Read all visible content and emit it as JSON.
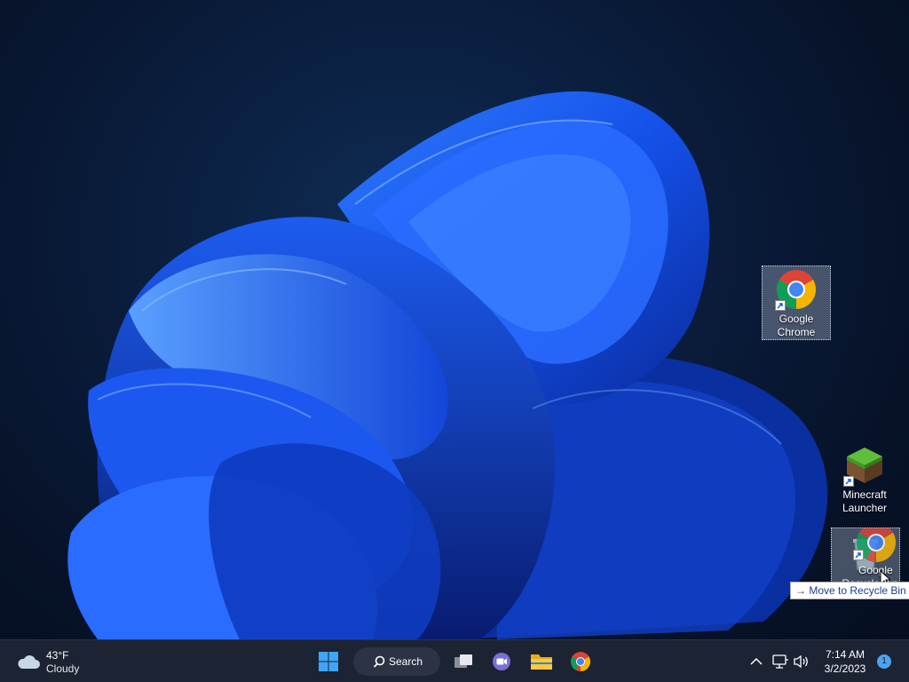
{
  "desktop": {
    "icons": [
      {
        "label_line1": "Google",
        "label_line2": "Chrome",
        "icon": "chrome-icon",
        "selected": true
      },
      {
        "label_line1": "Minecraft",
        "label_line2": "Launcher",
        "icon": "minecraft-icon",
        "selected": false
      },
      {
        "label_line1": "Google",
        "label_line2": "Recycle Bin",
        "icon": "chrome-icon-dragged",
        "selected": true
      }
    ],
    "drag_tooltip": "Move to Recycle Bin"
  },
  "taskbar": {
    "weather": {
      "temp": "43°F",
      "condition": "Cloudy",
      "icon": "cloud-icon"
    },
    "search_label": "Search",
    "pinned": [
      "start-icon",
      "search",
      "task-view-icon",
      "teams-chat-icon",
      "file-explorer-icon",
      "chrome-icon"
    ],
    "clock": {
      "time": "7:14 AM",
      "date": "3/2/2023"
    },
    "notification_count": "1"
  },
  "colors": {
    "accent": "#0a5cff",
    "taskbar": "#1c2333",
    "tooltip_text": "#1a3e8c"
  }
}
